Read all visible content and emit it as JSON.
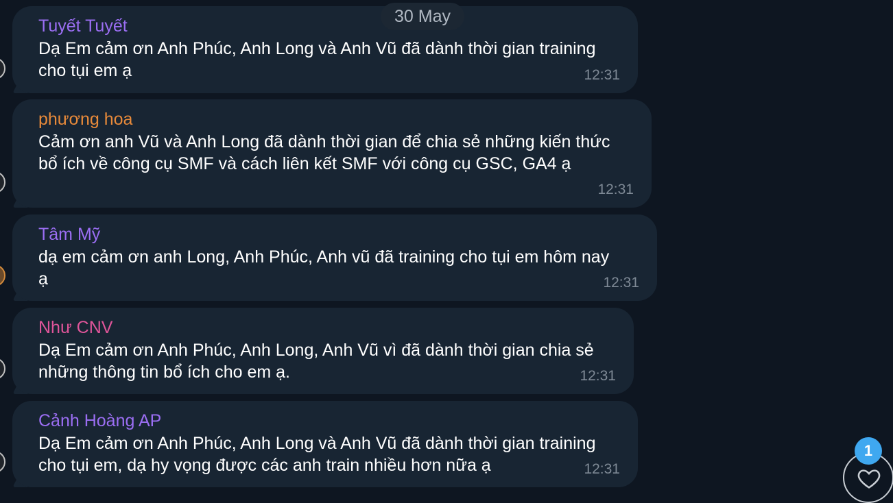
{
  "date_separator": "30 May",
  "messages": [
    {
      "sender": "Tuyết Tuyết",
      "sender_color": "#9b6ef3",
      "lines": [
        "Dạ Em cảm ơn Anh Phúc, Anh Long và Anh Vũ đã dành thời gian training",
        "cho tụi em ạ"
      ],
      "time": "12:31"
    },
    {
      "sender": "phương hoa",
      "sender_color": "#e88a3a",
      "lines": [
        "Cảm ơn anh Vũ và Anh Long đã dành thời gian để chia sẻ những kiến thức",
        "bổ ích về công cụ SMF và cách liên kết SMF với công cụ GSC, GA4 ạ"
      ],
      "time": "12:31"
    },
    {
      "sender": "Tâm Mỹ",
      "sender_color": "#9b6ef3",
      "lines": [
        "dạ em cảm ơn anh Long, Anh Phúc, Anh vũ đã training cho tụi em hôm nay",
        "ạ"
      ],
      "time": "12:31"
    },
    {
      "sender": "Như CNV",
      "sender_color": "#e0559a",
      "lines": [
        "Dạ Em cảm ơn Anh Phúc, Anh Long, Anh Vũ vì đã dành thời gian chia sẻ",
        "những thông tin bổ ích cho em ạ."
      ],
      "time": "12:31"
    },
    {
      "sender": "Cảnh Hoàng AP",
      "sender_color": "#9b6ef3",
      "lines": [
        "Dạ Em cảm ơn Anh Phúc, Anh Long và Anh Vũ đã dành thời gian training",
        "cho tụi em, dạ hy vọng được các anh train nhiều hơn nữa ạ"
      ],
      "time": "12:31"
    }
  ],
  "reactions": {
    "icon": "heart-icon",
    "unread_count": "1"
  }
}
